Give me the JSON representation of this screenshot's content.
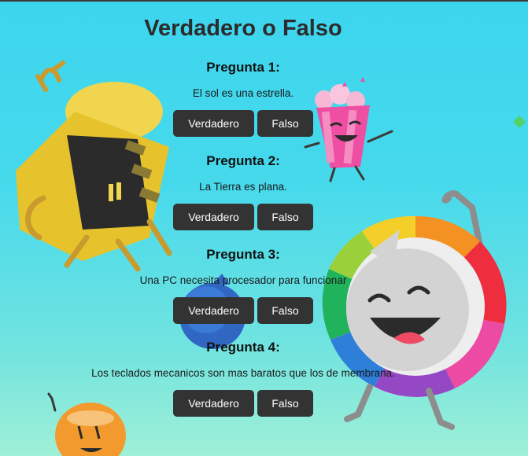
{
  "page": {
    "title": "Verdadero o Falso"
  },
  "questions": [
    {
      "heading": "Pregunta 1:",
      "text": "El sol es una estrella.",
      "true_label": "Verdadero",
      "false_label": "Falso"
    },
    {
      "heading": "Pregunta 2:",
      "text": "La Tierra es plana.",
      "true_label": "Verdadero",
      "false_label": "Falso"
    },
    {
      "heading": "Pregunta 3:",
      "text": "Una PC necesita procesador para funcionar",
      "true_label": "Verdadero",
      "false_label": "Falso"
    },
    {
      "heading": "Pregunta 4:",
      "text": "Los teclados mecanicos son mas baratos que los de membrana.",
      "true_label": "Verdadero",
      "false_label": "Falso"
    }
  ],
  "colors": {
    "button_bg": "#333333",
    "button_text": "#ffffff",
    "background_top": "#3cd5ee",
    "background_bottom": "#9ff0d6"
  }
}
